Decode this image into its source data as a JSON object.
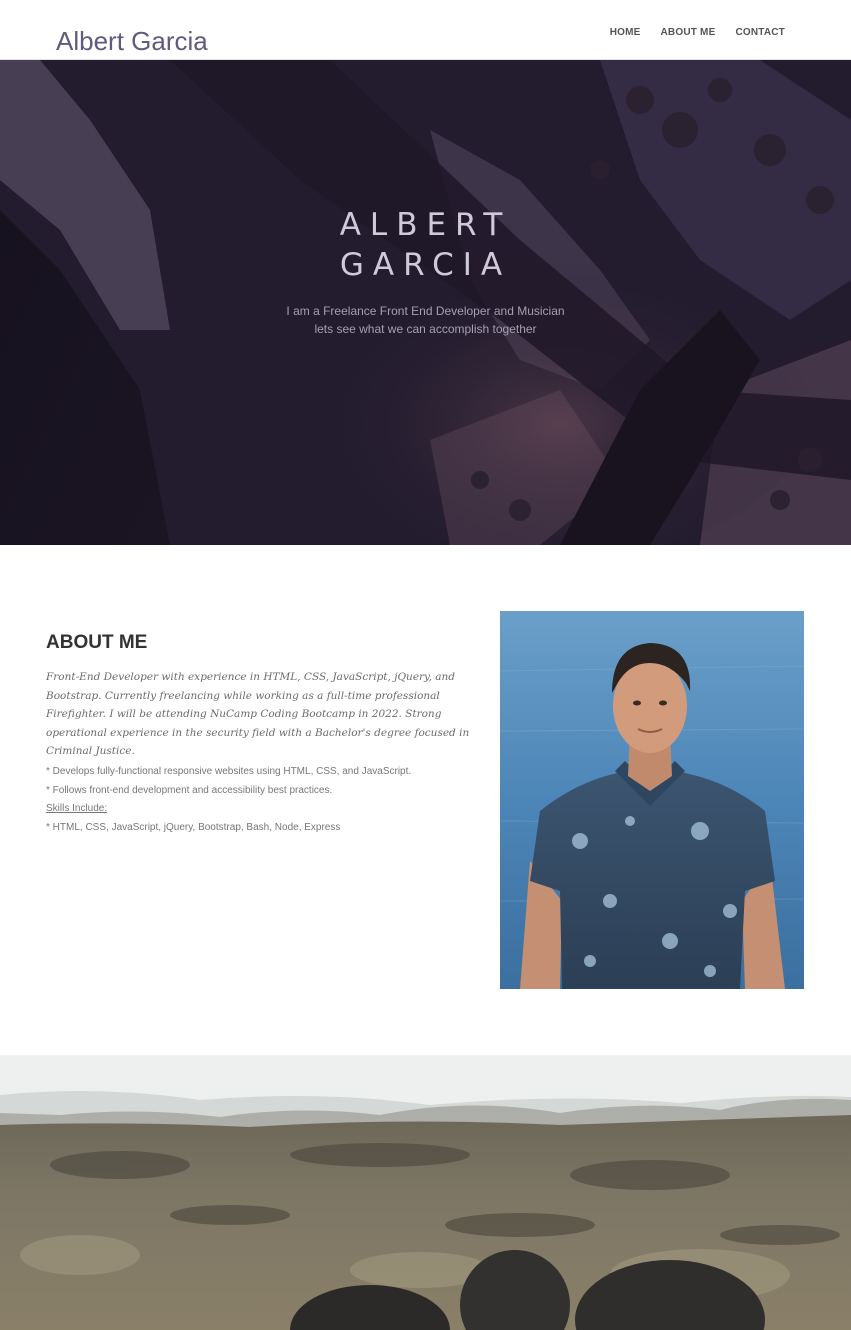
{
  "header": {
    "brand": "Albert Garcia",
    "nav": [
      {
        "label": "HOME"
      },
      {
        "label": "ABOUT ME"
      },
      {
        "label": "CONTACT"
      }
    ]
  },
  "hero": {
    "title_line1": "ALBERT",
    "title_line2": "GARCIA",
    "subtitle_line1": "I am a Freelance Front End Developer and Musician",
    "subtitle_line2": "lets see what we can accomplish together"
  },
  "about": {
    "heading": "ABOUT ME",
    "bio": "Front-End Developer with experience in HTML, CSS, JavaScript, jQuery, and Bootstrap. Currently freelancing while working as a full-time professional Firefighter. I will be attending NuCamp Coding Bootcamp in 2022. Strong operational experience in the security field with a Bachelor's degree focused in Criminal Justice.",
    "bullets": [
      "* Develops fully-functional responsive websites using HTML, CSS, and JavaScript.",
      "* Follows front-end development and accessibility best practices."
    ],
    "skills_label": "Skills Include:",
    "skills": "* HTML, CSS, JavaScript, jQuery, Bootstrap, Bash, Node, Express"
  },
  "colors": {
    "brand": "#5f5a7e",
    "hero_overlay": "#201a2c",
    "heading": "#333333"
  }
}
